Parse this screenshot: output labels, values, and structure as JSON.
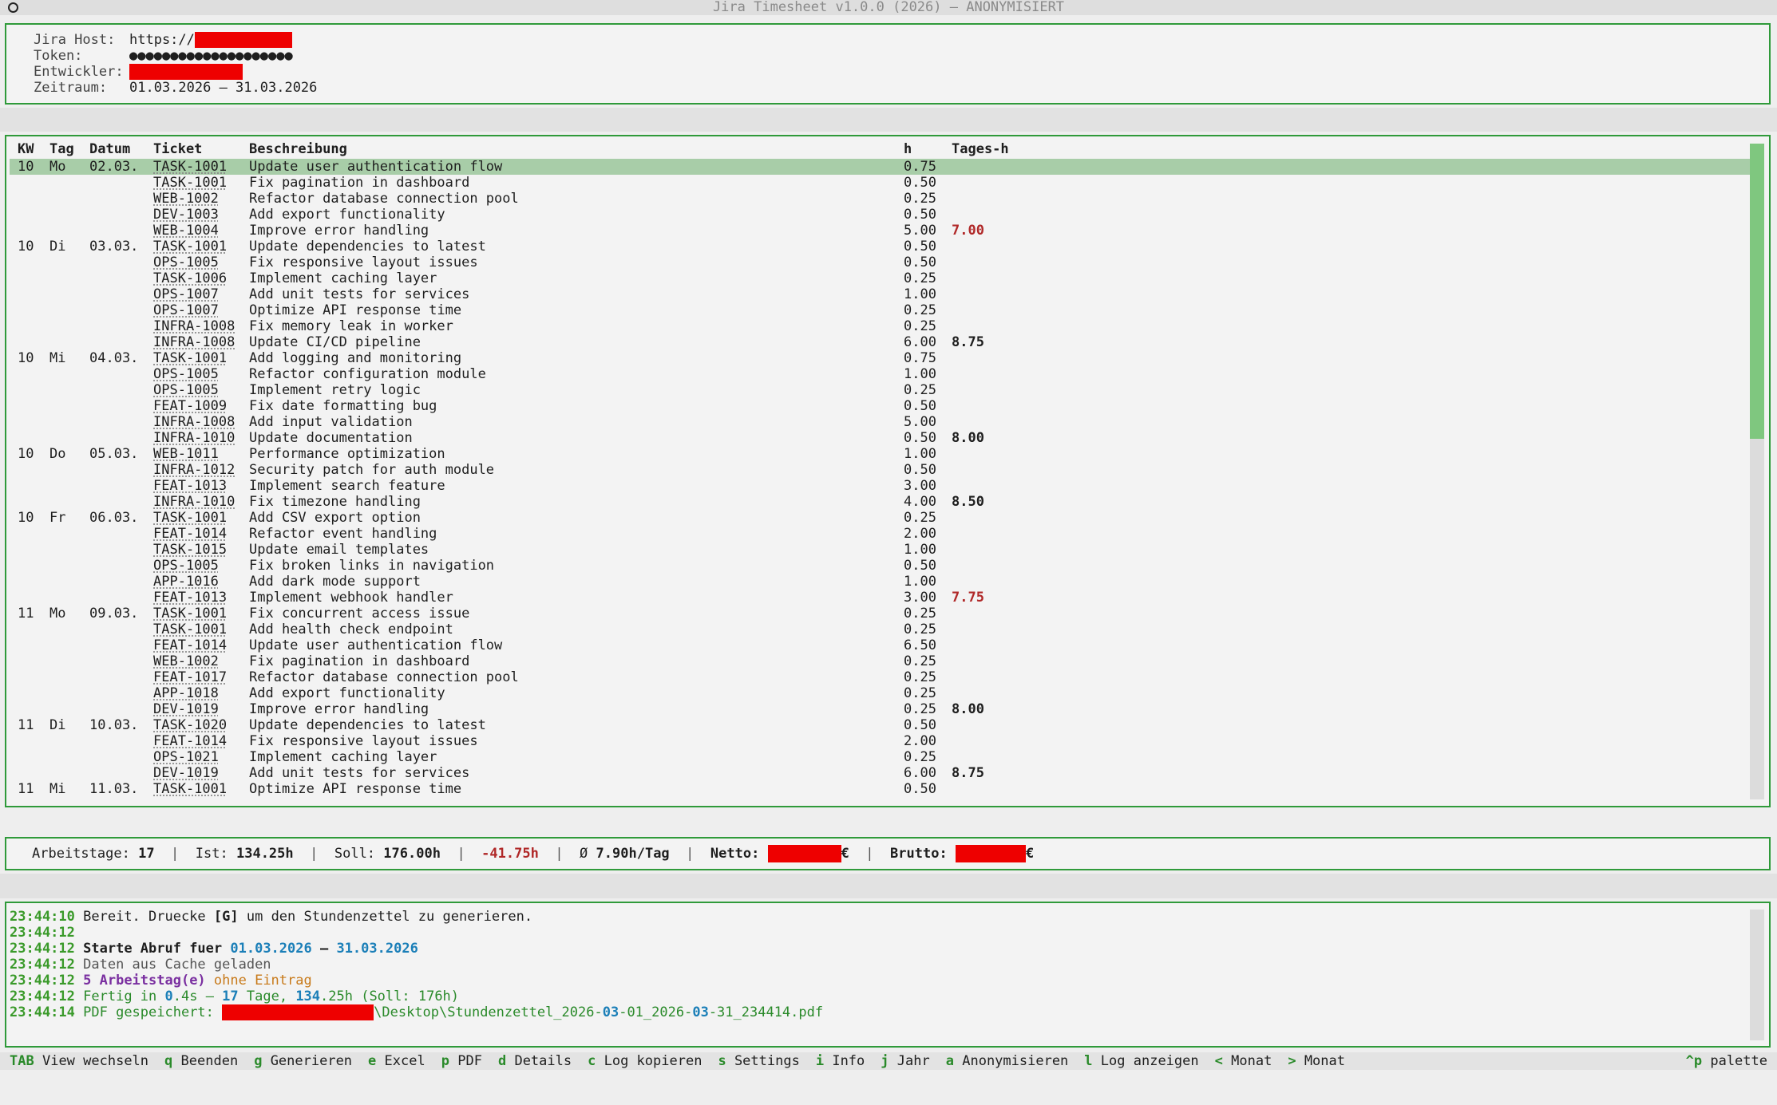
{
  "window": {
    "title": "Jira Timesheet v1.0.0 (2026) — ANONYMISIERT"
  },
  "config": {
    "host_label": "Jira Host:",
    "host_value": "https://",
    "token_label": "Token:",
    "token_value": "●●●●●●●●●●●●●●●●●●●●",
    "dev_label": "Entwickler:",
    "range_label": "Zeitraum:",
    "range_value": "01.03.2026 – 31.03.2026"
  },
  "table": {
    "headers": {
      "kw": "KW",
      "tag": "Tag",
      "datum": "Datum",
      "ticket": "Ticket",
      "beschreibung": "Beschreibung",
      "h": "h",
      "tages_h": "Tages-h"
    },
    "rows": [
      {
        "kw": "10",
        "tag": "Mo",
        "datum": "02.03.",
        "ticket": "TASK-1001",
        "desc": "Update user authentication flow",
        "h": "0.75",
        "th": "",
        "low": false,
        "selected": true
      },
      {
        "kw": "",
        "tag": "",
        "datum": "",
        "ticket": "TASK-1001",
        "desc": "Fix pagination in dashboard",
        "h": "0.50",
        "th": "",
        "low": false
      },
      {
        "kw": "",
        "tag": "",
        "datum": "",
        "ticket": "WEB-1002",
        "desc": "Refactor database connection pool",
        "h": "0.25",
        "th": "",
        "low": false
      },
      {
        "kw": "",
        "tag": "",
        "datum": "",
        "ticket": "DEV-1003",
        "desc": "Add export functionality",
        "h": "0.50",
        "th": "",
        "low": false
      },
      {
        "kw": "",
        "tag": "",
        "datum": "",
        "ticket": "WEB-1004",
        "desc": "Improve error handling",
        "h": "5.00",
        "th": "7.00",
        "low": true
      },
      {
        "kw": "10",
        "tag": "Di",
        "datum": "03.03.",
        "ticket": "TASK-1001",
        "desc": "Update dependencies to latest",
        "h": "0.50",
        "th": "",
        "low": false
      },
      {
        "kw": "",
        "tag": "",
        "datum": "",
        "ticket": "OPS-1005",
        "desc": "Fix responsive layout issues",
        "h": "0.50",
        "th": "",
        "low": false
      },
      {
        "kw": "",
        "tag": "",
        "datum": "",
        "ticket": "TASK-1006",
        "desc": "Implement caching layer",
        "h": "0.25",
        "th": "",
        "low": false
      },
      {
        "kw": "",
        "tag": "",
        "datum": "",
        "ticket": "OPS-1007",
        "desc": "Add unit tests for services",
        "h": "1.00",
        "th": "",
        "low": false
      },
      {
        "kw": "",
        "tag": "",
        "datum": "",
        "ticket": "OPS-1007",
        "desc": "Optimize API response time",
        "h": "0.25",
        "th": "",
        "low": false
      },
      {
        "kw": "",
        "tag": "",
        "datum": "",
        "ticket": "INFRA-1008",
        "desc": "Fix memory leak in worker",
        "h": "0.25",
        "th": "",
        "low": false
      },
      {
        "kw": "",
        "tag": "",
        "datum": "",
        "ticket": "INFRA-1008",
        "desc": "Update CI/CD pipeline",
        "h": "6.00",
        "th": "8.75",
        "low": false
      },
      {
        "kw": "10",
        "tag": "Mi",
        "datum": "04.03.",
        "ticket": "TASK-1001",
        "desc": "Add logging and monitoring",
        "h": "0.75",
        "th": "",
        "low": false
      },
      {
        "kw": "",
        "tag": "",
        "datum": "",
        "ticket": "OPS-1005",
        "desc": "Refactor configuration module",
        "h": "1.00",
        "th": "",
        "low": false
      },
      {
        "kw": "",
        "tag": "",
        "datum": "",
        "ticket": "OPS-1005",
        "desc": "Implement retry logic",
        "h": "0.25",
        "th": "",
        "low": false
      },
      {
        "kw": "",
        "tag": "",
        "datum": "",
        "ticket": "FEAT-1009",
        "desc": "Fix date formatting bug",
        "h": "0.50",
        "th": "",
        "low": false
      },
      {
        "kw": "",
        "tag": "",
        "datum": "",
        "ticket": "INFRA-1008",
        "desc": "Add input validation",
        "h": "5.00",
        "th": "",
        "low": false
      },
      {
        "kw": "",
        "tag": "",
        "datum": "",
        "ticket": "INFRA-1010",
        "desc": "Update documentation",
        "h": "0.50",
        "th": "8.00",
        "low": false
      },
      {
        "kw": "10",
        "tag": "Do",
        "datum": "05.03.",
        "ticket": "WEB-1011",
        "desc": "Performance optimization",
        "h": "1.00",
        "th": "",
        "low": false
      },
      {
        "kw": "",
        "tag": "",
        "datum": "",
        "ticket": "INFRA-1012",
        "desc": "Security patch for auth module",
        "h": "0.50",
        "th": "",
        "low": false
      },
      {
        "kw": "",
        "tag": "",
        "datum": "",
        "ticket": "FEAT-1013",
        "desc": "Implement search feature",
        "h": "3.00",
        "th": "",
        "low": false
      },
      {
        "kw": "",
        "tag": "",
        "datum": "",
        "ticket": "INFRA-1010",
        "desc": "Fix timezone handling",
        "h": "4.00",
        "th": "8.50",
        "low": false
      },
      {
        "kw": "10",
        "tag": "Fr",
        "datum": "06.03.",
        "ticket": "TASK-1001",
        "desc": "Add CSV export option",
        "h": "0.25",
        "th": "",
        "low": false
      },
      {
        "kw": "",
        "tag": "",
        "datum": "",
        "ticket": "FEAT-1014",
        "desc": "Refactor event handling",
        "h": "2.00",
        "th": "",
        "low": false
      },
      {
        "kw": "",
        "tag": "",
        "datum": "",
        "ticket": "TASK-1015",
        "desc": "Update email templates",
        "h": "1.00",
        "th": "",
        "low": false
      },
      {
        "kw": "",
        "tag": "",
        "datum": "",
        "ticket": "OPS-1005",
        "desc": "Fix broken links in navigation",
        "h": "0.50",
        "th": "",
        "low": false
      },
      {
        "kw": "",
        "tag": "",
        "datum": "",
        "ticket": "APP-1016",
        "desc": "Add dark mode support",
        "h": "1.00",
        "th": "",
        "low": false
      },
      {
        "kw": "",
        "tag": "",
        "datum": "",
        "ticket": "FEAT-1013",
        "desc": "Implement webhook handler",
        "h": "3.00",
        "th": "7.75",
        "low": true
      },
      {
        "kw": "11",
        "tag": "Mo",
        "datum": "09.03.",
        "ticket": "TASK-1001",
        "desc": "Fix concurrent access issue",
        "h": "0.25",
        "th": "",
        "low": false
      },
      {
        "kw": "",
        "tag": "",
        "datum": "",
        "ticket": "TASK-1001",
        "desc": "Add health check endpoint",
        "h": "0.25",
        "th": "",
        "low": false
      },
      {
        "kw": "",
        "tag": "",
        "datum": "",
        "ticket": "FEAT-1014",
        "desc": "Update user authentication flow",
        "h": "6.50",
        "th": "",
        "low": false
      },
      {
        "kw": "",
        "tag": "",
        "datum": "",
        "ticket": "WEB-1002",
        "desc": "Fix pagination in dashboard",
        "h": "0.25",
        "th": "",
        "low": false
      },
      {
        "kw": "",
        "tag": "",
        "datum": "",
        "ticket": "FEAT-1017",
        "desc": "Refactor database connection pool",
        "h": "0.25",
        "th": "",
        "low": false
      },
      {
        "kw": "",
        "tag": "",
        "datum": "",
        "ticket": "APP-1018",
        "desc": "Add export functionality",
        "h": "0.25",
        "th": "",
        "low": false
      },
      {
        "kw": "",
        "tag": "",
        "datum": "",
        "ticket": "DEV-1019",
        "desc": "Improve error handling",
        "h": "0.25",
        "th": "8.00",
        "low": false
      },
      {
        "kw": "11",
        "tag": "Di",
        "datum": "10.03.",
        "ticket": "TASK-1020",
        "desc": "Update dependencies to latest",
        "h": "0.50",
        "th": "",
        "low": false
      },
      {
        "kw": "",
        "tag": "",
        "datum": "",
        "ticket": "FEAT-1014",
        "desc": "Fix responsive layout issues",
        "h": "2.00",
        "th": "",
        "low": false
      },
      {
        "kw": "",
        "tag": "",
        "datum": "",
        "ticket": "OPS-1021",
        "desc": "Implement caching layer",
        "h": "0.25",
        "th": "",
        "low": false
      },
      {
        "kw": "",
        "tag": "",
        "datum": "",
        "ticket": "DEV-1019",
        "desc": "Add unit tests for services",
        "h": "6.00",
        "th": "8.75",
        "low": false
      },
      {
        "kw": "11",
        "tag": "Mi",
        "datum": "11.03.",
        "ticket": "TASK-1001",
        "desc": "Optimize API response time",
        "h": "0.50",
        "th": "",
        "low": false
      }
    ],
    "scroll_fraction_visible": 0.45
  },
  "summary": {
    "arbeitstage_label": "Arbeitstage:",
    "arbeitstage": "17",
    "ist_label": "Ist:",
    "ist": "134.25h",
    "soll_label": "Soll:",
    "soll": "176.00h",
    "diff": "-41.75h",
    "avg_label": "Ø",
    "avg": "7.90h/Tag",
    "netto_label": "Netto:",
    "brutto_label": "Brutto:",
    "currency": "€",
    "sep": "|"
  },
  "log": {
    "lines": [
      {
        "ts": "23:44:10",
        "parts": [
          {
            "t": "Bereit. Druecke ",
            "c": ""
          },
          {
            "t": "[G]",
            "c": "bold"
          },
          {
            "t": " um den Stundenzettel zu generieren.",
            "c": ""
          }
        ]
      },
      {
        "ts": "23:44:12",
        "parts": []
      },
      {
        "ts": "23:44:12",
        "parts": [
          {
            "t": "Starte Abruf fuer ",
            "c": "bold"
          },
          {
            "t": "01.03.2026",
            "c": "blue"
          },
          {
            "t": " – ",
            "c": "bold"
          },
          {
            "t": "31.03.2026",
            "c": "blue"
          }
        ]
      },
      {
        "ts": "23:44:12",
        "parts": [
          {
            "t": "Daten aus Cache geladen",
            "c": "gray"
          }
        ]
      },
      {
        "ts": "23:44:12",
        "parts": [
          {
            "t": "5 Arbeitstag(e)",
            "c": "purple"
          },
          {
            "t": " ohne Eintrag",
            "c": "orange"
          }
        ]
      },
      {
        "ts": "23:44:12",
        "parts": [
          {
            "t": "Fertig in ",
            "c": "green"
          },
          {
            "t": "0",
            "c": "blue"
          },
          {
            "t": ".4s – ",
            "c": "green"
          },
          {
            "t": "17",
            "c": "blue"
          },
          {
            "t": " Tage, ",
            "c": "green"
          },
          {
            "t": "134",
            "c": "blue"
          },
          {
            "t": ".25h (Soll: 176h)",
            "c": "green"
          }
        ]
      },
      {
        "ts": "23:44:14",
        "parts": [
          {
            "t": "PDF gespeichert: ",
            "c": "green"
          },
          {
            "t": "",
            "c": "redact"
          },
          {
            "t": "\\Desktop\\Stundenzettel_2026-",
            "c": "green"
          },
          {
            "t": "03",
            "c": "blue"
          },
          {
            "t": "-01_2026-",
            "c": "green"
          },
          {
            "t": "03",
            "c": "blue"
          },
          {
            "t": "-31_234414.pdf",
            "c": "green"
          }
        ]
      }
    ]
  },
  "footer": {
    "items": [
      {
        "key": "TAB",
        "label": "View wechseln"
      },
      {
        "key": "q",
        "label": "Beenden"
      },
      {
        "key": "g",
        "label": "Generieren"
      },
      {
        "key": "e",
        "label": "Excel"
      },
      {
        "key": "p",
        "label": "PDF"
      },
      {
        "key": "d",
        "label": "Details"
      },
      {
        "key": "c",
        "label": "Log kopieren"
      },
      {
        "key": "s",
        "label": "Settings"
      },
      {
        "key": "i",
        "label": "Info"
      },
      {
        "key": "j",
        "label": "Jahr"
      },
      {
        "key": "a",
        "label": "Anonymisieren"
      },
      {
        "key": "l",
        "label": "Log anzeigen"
      },
      {
        "key": "<",
        "label": "Monat"
      },
      {
        "key": ">",
        "label": "Monat"
      }
    ],
    "palette_key": "^p",
    "palette_label": "palette"
  },
  "colors": {
    "border": "#2f9a3a",
    "selected_row": "#a8cda8",
    "negative": "#b02828",
    "redaction": "#ee0000"
  }
}
